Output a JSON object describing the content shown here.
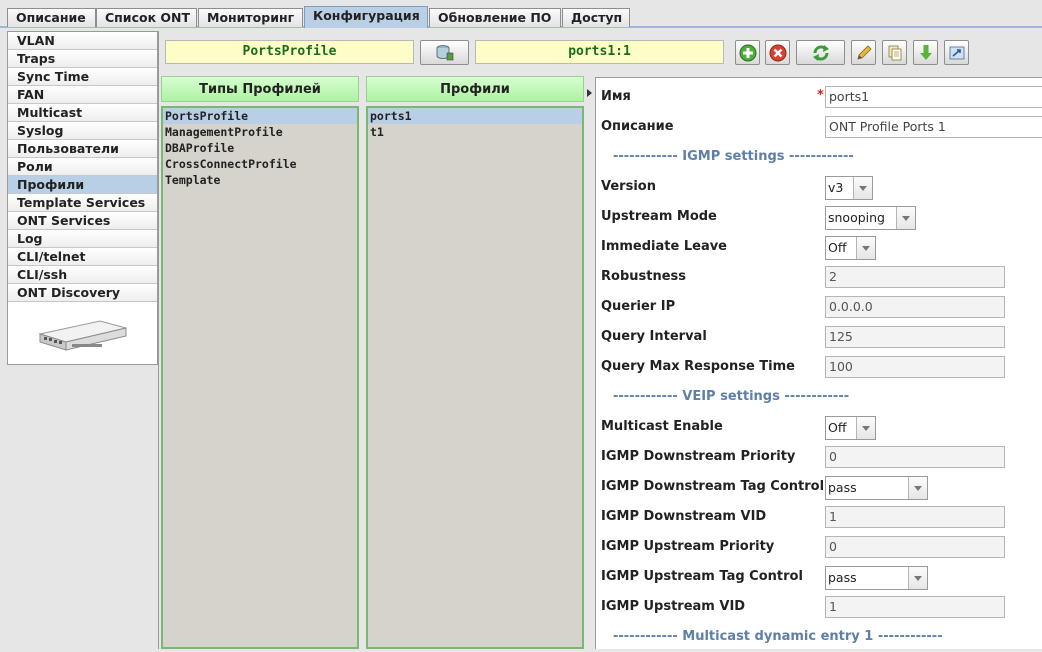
{
  "tabs": [
    "Описание",
    "Список ONT",
    "Мониторинг",
    "Конфигурация",
    "Обновление ПО",
    "Доступ"
  ],
  "active_tab": 3,
  "menu": [
    "VLAN",
    "Traps",
    "Sync Time",
    "FAN",
    "Multicast",
    "Syslog",
    "Пользователи",
    "Роли",
    "Профили",
    "Template Services",
    "ONT Services",
    "Log",
    "CLI/telnet",
    "CLI/ssh",
    "ONT Discovery"
  ],
  "menu_selected": 8,
  "toolbar": {
    "profile_type": "PortsProfile",
    "profile_name": "ports1:1",
    "icons": [
      "database-icon",
      "add-icon",
      "delete-icon",
      "refresh-icon",
      "edit-icon",
      "copy-icon",
      "download-icon",
      "export-icon"
    ]
  },
  "profile_types": {
    "header": "Типы Профилей",
    "items": [
      "PortsProfile",
      "ManagementProfile",
      "DBAProfile",
      "CrossConnectProfile",
      "Template"
    ],
    "selected": 0
  },
  "profiles": {
    "header": "Профили",
    "items": [
      "ports1",
      "t1"
    ],
    "selected": 0
  },
  "props": {
    "name": {
      "label": "Имя",
      "required": "*",
      "value": "ports1"
    },
    "description": {
      "label": "Описание",
      "value": "ONT Profile Ports 1"
    },
    "igmp_section": "------------ IGMP settings ------------",
    "version": {
      "label": "Version",
      "value": "v3"
    },
    "upstream_mode": {
      "label": "Upstream Mode",
      "value": "snooping"
    },
    "immediate_leave": {
      "label": "Immediate Leave",
      "value": "Off"
    },
    "robustness": {
      "label": "Robustness",
      "value": "2"
    },
    "querier_ip": {
      "label": "Querier IP",
      "value": "0.0.0.0"
    },
    "query_interval": {
      "label": "Query Interval",
      "value": "125"
    },
    "query_max_response": {
      "label": "Query Max Response Time",
      "value": "100"
    },
    "veip_section": "------------ VEIP settings ------------",
    "multicast_enable": {
      "label": "Multicast Enable",
      "value": "Off"
    },
    "igmp_ds_priority": {
      "label": "IGMP Downstream Priority",
      "value": "0"
    },
    "igmp_ds_tag": {
      "label": "IGMP Downstream Tag Control",
      "value": "pass"
    },
    "igmp_ds_vid": {
      "label": "IGMP Downstream VID",
      "value": "1"
    },
    "igmp_us_priority": {
      "label": "IGMP Upstream Priority",
      "value": "0"
    },
    "igmp_us_tag": {
      "label": "IGMP Upstream Tag Control",
      "value": "pass"
    },
    "igmp_us_vid": {
      "label": "IGMP Upstream VID",
      "value": "1"
    },
    "mc_dyn_section": "------------ Multicast dynamic entry 1 ------------"
  }
}
